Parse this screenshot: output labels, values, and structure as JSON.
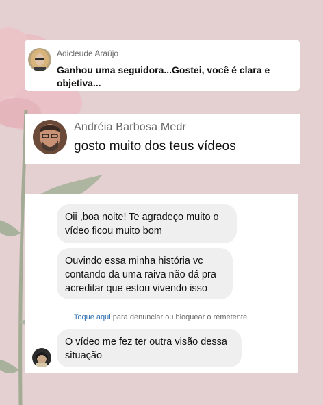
{
  "comment1": {
    "author": "Adicleude Araújo",
    "text": "Ganhou uma seguidora...Gostei, você é clara e objetiva..."
  },
  "comment2": {
    "author": "Andréia Barbosa Medr",
    "text": "gosto muito dos teus vídeos"
  },
  "chat": {
    "messages": [
      "Oii ,boa noite! Te agradeço muito o vídeo ficou muito bom",
      "Ouvindo essa minha história vc contando da uma raiva não dá pra acreditar que estou vivendo isso"
    ],
    "report_link": "Toque aqui",
    "report_text": "para denunciar ou bloquear o remetente.",
    "last_message": "O vídeo me fez ter outra visão dessa situação"
  },
  "colors": {
    "background": "#e4d0d1",
    "bubble": "#efefef",
    "link": "#2f6fb2"
  }
}
